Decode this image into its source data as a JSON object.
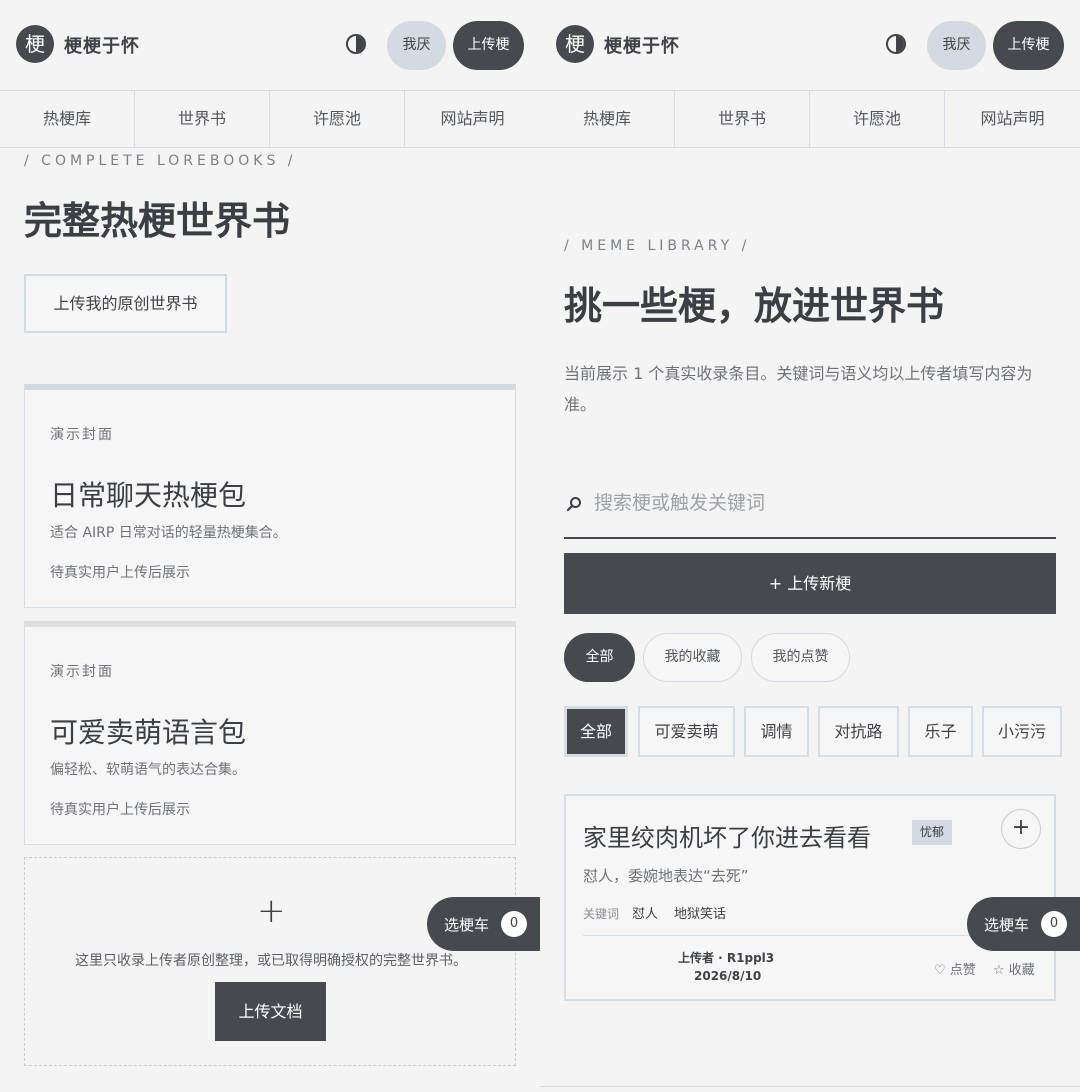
{
  "header": {
    "logo_char": "梗",
    "site_title": "梗梗于怀",
    "theme_icon": "half-circle-icon",
    "dislike_label": "我厌",
    "upload_label": "上传梗"
  },
  "nav": [
    "热梗库",
    "世界书",
    "许愿池",
    "网站声明"
  ],
  "left": {
    "eyebrow": "/ COMPLETE LOREBOOKS /",
    "title": "完整热梗世界书",
    "upload_button": "上传我的原创世界书",
    "cards": [
      {
        "tag": "演示封面",
        "name": "日常聊天热梗包",
        "desc": "适合 AIRP 日常对话的轻量热梗集合。",
        "status": "待真实用户上传后展示"
      },
      {
        "tag": "演示封面",
        "name": "可爱卖萌语言包",
        "desc": "偏轻松、软萌语气的表达合集。",
        "status": "待真实用户上传后展示"
      }
    ],
    "drop_zone": {
      "plus": "+",
      "text": "这里只收录上传者原创整理，或已取得明确授权的完整世界书。",
      "button": "上传文档"
    }
  },
  "cart": {
    "label": "选梗车",
    "count": "0"
  },
  "right": {
    "eyebrow": "/ MEME LIBRARY /",
    "title": "挑一些梗，放进世界书",
    "intro": "当前展示 1 个真实收录条目。关键词与语义均以上传者填写内容为准。",
    "search": {
      "placeholder": "搜索梗或触发关键词",
      "value": ""
    },
    "upload_new": "+ 上传新梗",
    "filters": [
      "全部",
      "我的收藏",
      "我的点赞"
    ],
    "categories": [
      "全部",
      "可爱卖萌",
      "调情",
      "对抗路",
      "乐子",
      "小污污"
    ],
    "meme": {
      "title": "家里绞肉机坏了你进去看看",
      "badge": "忧郁",
      "add": "+",
      "meaning": "怼人，委婉地表达“去死”",
      "keywords_label": "关键词",
      "keywords": [
        "怼人",
        "地狱笑话"
      ],
      "uploader": "上传者 · R1ppl3",
      "date": "2026/8/10",
      "like": "♡ 点赞",
      "fav": "☆ 收藏"
    }
  }
}
